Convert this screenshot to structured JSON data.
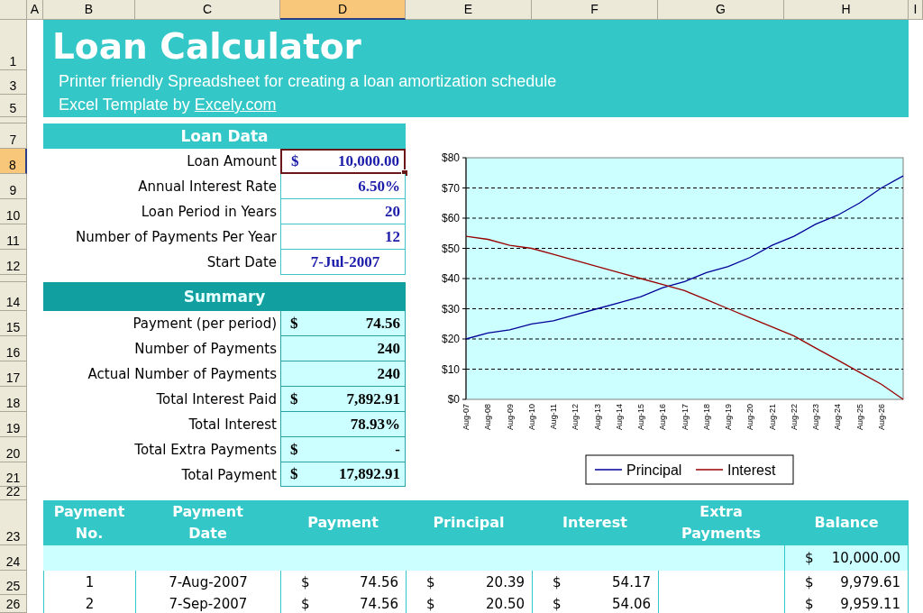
{
  "sheet": {
    "column_headers": [
      {
        "label": "A",
        "selected": false
      },
      {
        "label": "B",
        "selected": false
      },
      {
        "label": "C",
        "selected": false
      },
      {
        "label": "D",
        "selected": true
      },
      {
        "label": "E",
        "selected": false
      },
      {
        "label": "F",
        "selected": false
      },
      {
        "label": "G",
        "selected": false
      },
      {
        "label": "H",
        "selected": false
      },
      {
        "label": "I",
        "selected": false
      }
    ],
    "row_headers": [
      {
        "label": "1",
        "selected": false
      },
      {
        "label": "3",
        "selected": false
      },
      {
        "label": "5",
        "selected": false
      },
      {
        "label": "7",
        "selected": false
      },
      {
        "label": "8",
        "selected": true
      },
      {
        "label": "9",
        "selected": false
      },
      {
        "label": "10",
        "selected": false
      },
      {
        "label": "11",
        "selected": false
      },
      {
        "label": "12",
        "selected": false
      },
      {
        "label": "14",
        "selected": false
      },
      {
        "label": "15",
        "selected": false
      },
      {
        "label": "16",
        "selected": false
      },
      {
        "label": "17",
        "selected": false
      },
      {
        "label": "18",
        "selected": false
      },
      {
        "label": "19",
        "selected": false
      },
      {
        "label": "20",
        "selected": false
      },
      {
        "label": "21",
        "selected": false
      },
      {
        "label": "22",
        "selected": false
      },
      {
        "label": "23",
        "selected": false
      },
      {
        "label": "24",
        "selected": false
      },
      {
        "label": "25",
        "selected": false
      },
      {
        "label": "26",
        "selected": false
      }
    ]
  },
  "header": {
    "title": "Loan Calculator",
    "subtitle": "Printer friendly Spreadsheet for creating a loan amortization schedule",
    "credit": {
      "text": "Excel Template by",
      "link": "Excely.com"
    }
  },
  "loan_data": {
    "title": "Loan Data",
    "rows": [
      {
        "label": "Loan Amount",
        "kind": "money",
        "currency": "$",
        "value": "10,000.00",
        "selected": true
      },
      {
        "label": "Annual Interest Rate",
        "kind": "number",
        "value": "6.50%",
        "selected": false
      },
      {
        "label": "Loan Period in Years",
        "kind": "number",
        "value": "20",
        "selected": false
      },
      {
        "label": "Number of Payments Per Year",
        "kind": "number",
        "value": "12",
        "selected": false
      },
      {
        "label": "Start Date",
        "kind": "date",
        "value": "7-Jul-2007",
        "selected": false
      }
    ]
  },
  "summary": {
    "title": "Summary",
    "rows": [
      {
        "label": "Payment (per period)",
        "currency": "$",
        "value": "74.56"
      },
      {
        "label": "Number of Payments",
        "value": "240"
      },
      {
        "label": "Actual Number of Payments",
        "value": "240"
      },
      {
        "label": "Total Interest Paid",
        "currency": "$",
        "value": "7,892.91"
      },
      {
        "label": "Total Interest",
        "value": "78.93%"
      },
      {
        "label": "Total Extra Payments",
        "currency": "$",
        "value": "-"
      },
      {
        "label": "Total Payment",
        "currency": "$",
        "value": "17,892.91"
      }
    ]
  },
  "chart": {
    "chart_data": {
      "type": "line",
      "categories": [
        "Aug-07",
        "Aug-08",
        "Aug-09",
        "Aug-10",
        "Aug-11",
        "Aug-12",
        "Aug-13",
        "Aug-14",
        "Aug-15",
        "Aug-16",
        "Aug-17",
        "Aug-18",
        "Aug-19",
        "Aug-20",
        "Aug-21",
        "Aug-22",
        "Aug-23",
        "Aug-24",
        "Aug-25",
        "Aug-26",
        null
      ],
      "ylim": [
        0,
        80
      ],
      "yticks": [
        {
          "value": 0,
          "label": "$0"
        },
        {
          "value": 10,
          "label": "$10"
        },
        {
          "value": 20,
          "label": "$20"
        },
        {
          "value": 30,
          "label": "$30"
        },
        {
          "value": 40,
          "label": "$40"
        },
        {
          "value": 50,
          "label": "$50"
        },
        {
          "value": 60,
          "label": "$60"
        },
        {
          "value": 70,
          "label": "$70"
        },
        {
          "value": 80,
          "label": "$80"
        }
      ],
      "grid": true,
      "legend": "bottom",
      "series": [
        {
          "name": "Principal",
          "color": "#000099",
          "values": [
            20,
            22,
            23,
            25,
            26,
            28,
            30,
            32,
            34,
            37,
            39,
            42,
            44,
            47,
            51,
            54,
            58,
            61,
            65,
            70,
            74
          ]
        },
        {
          "name": "Interest",
          "color": "#990000",
          "values": [
            54,
            53,
            51,
            50,
            48,
            46,
            44,
            42,
            40,
            38,
            36,
            33,
            30,
            27,
            24,
            21,
            17,
            13,
            9,
            5,
            0
          ]
        }
      ]
    }
  },
  "schedule": {
    "columns": [
      "Payment No.",
      "Payment Date",
      "Payment",
      "Principal",
      "Interest",
      "Extra Payments",
      "Balance"
    ],
    "opening_balance": {
      "currency": "$",
      "value": "10,000.00"
    },
    "rows": [
      {
        "number": "1",
        "date": "7-Aug-2007",
        "payment": {
          "currency": "$",
          "value": "74.56"
        },
        "principal": {
          "currency": "$",
          "value": "20.39"
        },
        "interest": {
          "currency": "$",
          "value": "54.17"
        },
        "balance": {
          "currency": "$",
          "value": "9,979.61"
        }
      },
      {
        "number": "2",
        "date": "7-Sep-2007",
        "payment": {
          "currency": "$",
          "value": "74.56"
        },
        "principal": {
          "currency": "$",
          "value": "20.50"
        },
        "interest": {
          "currency": "$",
          "value": "54.06"
        },
        "balance": {
          "currency": "$",
          "value": "9,959.11"
        }
      }
    ]
  }
}
